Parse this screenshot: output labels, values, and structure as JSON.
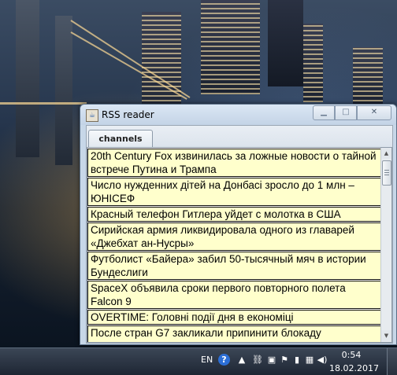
{
  "window": {
    "title": "RSS reader",
    "app_icon": "java-icon",
    "controls": {
      "minimize": "minimize-icon",
      "maximize": "maximize-icon",
      "close": "close-icon"
    }
  },
  "tabs": [
    {
      "label": "channels",
      "selected": true
    }
  ],
  "news": [
    "20th Century Fox извинилась за ложные новости о тайной встрече Путина и Трампа",
    "Число нужденних дітей на Донбасі зросло до 1 млн – ЮНІСЕФ",
    "Красный телефон Гитлера уйдет с молотка в США",
    "Сирийская армия ликвидировала одного из главарей «Джебхат ан-Нусры»",
    "Футболист «Байера» забил 50-тысячный мяч в истории Бундеслиги",
    "SpaceX объявила сроки первого повторного полета Falcon 9",
    "OVERTIME: Головні події дня в економіці",
    "После стран G7 закликали припинити блокаду"
  ],
  "taskbar": {
    "language": "EN",
    "time": "0:54",
    "date": "18.02.2017",
    "tray_icons": [
      "help-icon",
      "hidden-icons-arrow",
      "network-devices-icon",
      "input-device-icon",
      "action-center-flag-icon",
      "power-icon",
      "network-icon",
      "volume-icon"
    ]
  }
}
